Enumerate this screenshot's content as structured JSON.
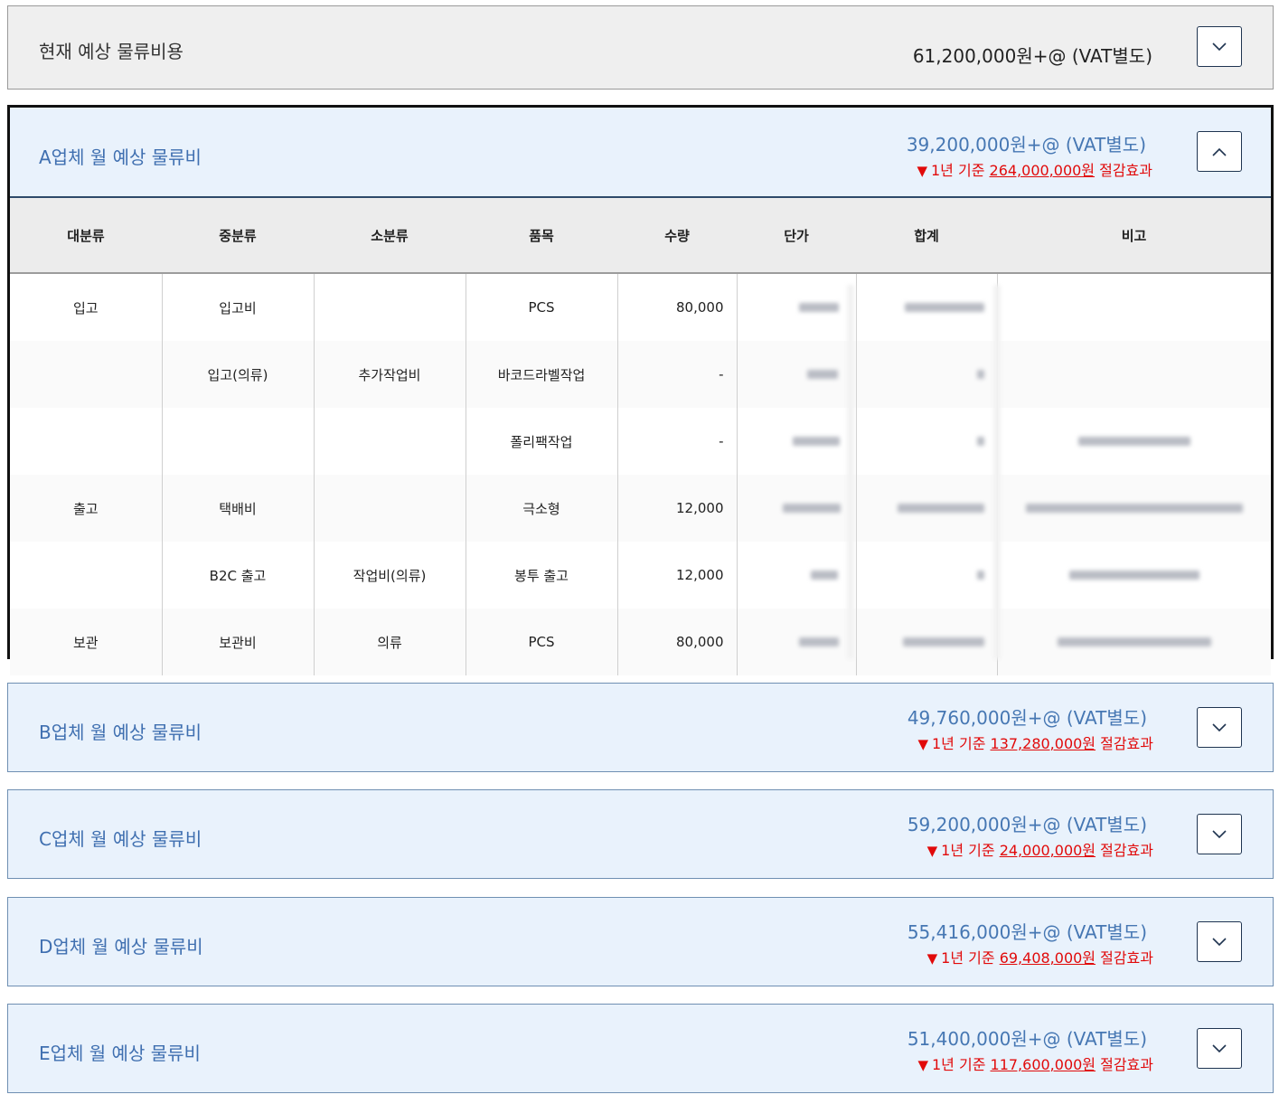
{
  "current": {
    "title": "현재 예상 물류비용",
    "amount": "61,200,000원+@ (VAT별도)"
  },
  "vendors": {
    "a": {
      "title": "A업체 월 예상 물류비",
      "amount": "39,200,000원+@ (VAT별도)",
      "saving_prefix": "1년 기준 ",
      "saving_value": "264,000,000원",
      "saving_suffix": " 절감효과"
    },
    "b": {
      "title": "B업체 월 예상 물류비",
      "amount": "49,760,000원+@ (VAT별도)",
      "saving_prefix": "1년 기준 ",
      "saving_value": "137,280,000원",
      "saving_suffix": " 절감효과"
    },
    "c": {
      "title": "C업체 월 예상 물류비",
      "amount": "59,200,000원+@ (VAT별도)",
      "saving_prefix": "1년 기준 ",
      "saving_value": "24,000,000원",
      "saving_suffix": " 절감효과"
    },
    "d": {
      "title": "D업체 월 예상 물류비",
      "amount": "55,416,000원+@ (VAT별도)",
      "saving_prefix": "1년 기준 ",
      "saving_value": "69,408,000원",
      "saving_suffix": " 절감효과"
    },
    "e": {
      "title": "E업체 월 예상 물류비",
      "amount": "51,400,000원+@ (VAT별도)",
      "saving_prefix": "1년 기준 ",
      "saving_value": "117,600,000원",
      "saving_suffix": " 절감효과"
    }
  },
  "table": {
    "headers": [
      "대분류",
      "중분류",
      "소분류",
      "품목",
      "수량",
      "단가",
      "합계",
      "비고"
    ],
    "rows": [
      [
        "입고",
        "입고비",
        "",
        "PCS",
        "80,000"
      ],
      [
        "",
        "입고(의류)",
        "추가작업비",
        "바코드라벨작업",
        "-"
      ],
      [
        "",
        "",
        "",
        "폴리팩작업",
        "-"
      ],
      [
        "출고",
        "택배비",
        "",
        "극소형",
        "12,000"
      ],
      [
        "",
        "B2C 출고",
        "작업비(의류)",
        "봉투 출고",
        "12,000"
      ],
      [
        "보관",
        "보관비",
        "의류",
        "PCS",
        "80,000"
      ]
    ]
  },
  "icons": {
    "collapsed": "chevron-down-icon",
    "expanded": "chevron-up-icon"
  },
  "colors": {
    "accent_blue": "#3f6fb0",
    "saving_red": "#e10a0a",
    "panel_bg": "#e9f2fc"
  }
}
